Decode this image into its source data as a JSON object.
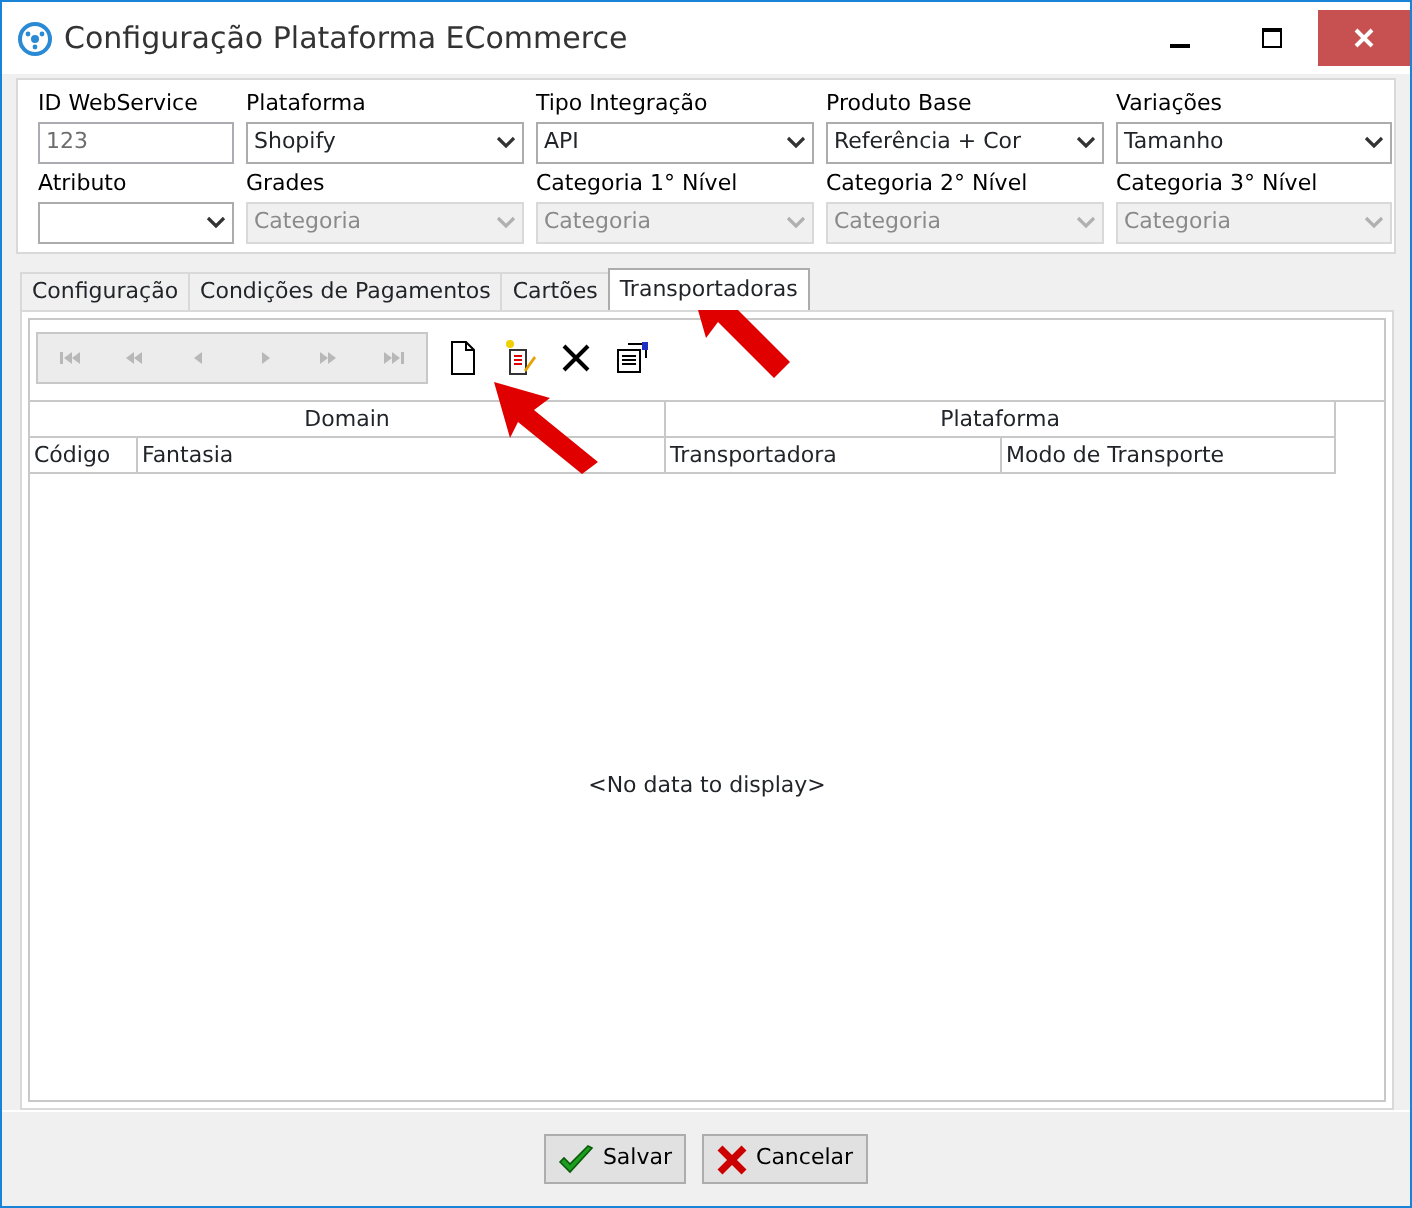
{
  "window": {
    "title": "Configuração Plataforma ECommerce"
  },
  "fields": [
    {
      "label": "ID WebService",
      "kind": "text",
      "value": "123",
      "disabled": false
    },
    {
      "label": "Plataforma",
      "kind": "select",
      "value": "Shopify",
      "disabled": false
    },
    {
      "label": "Tipo Integração",
      "kind": "select",
      "value": "API",
      "disabled": false
    },
    {
      "label": "Produto Base",
      "kind": "select",
      "value": "Referência + Cor",
      "disabled": false
    },
    {
      "label": "Variações",
      "kind": "select",
      "value": "Tamanho",
      "disabled": false
    },
    {
      "label": "Atributo",
      "kind": "select",
      "disabled": false
    },
    {
      "label": "Grades",
      "kind": "select",
      "value": "Categoria",
      "disabled": true
    },
    {
      "label": "Categoria 1° Nível",
      "kind": "select",
      "value": "Categoria",
      "disabled": true
    },
    {
      "label": "Categoria 2° Nível",
      "kind": "select",
      "value": "Categoria",
      "disabled": true
    },
    {
      "label": "Categoria 3° Nível",
      "kind": "select",
      "value": "Categoria",
      "disabled": true
    }
  ],
  "tabs": [
    {
      "label": "Configuração",
      "selected": false
    },
    {
      "label": "Condições de Pagamentos",
      "selected": false
    },
    {
      "label": "Cartões",
      "selected": false
    },
    {
      "label": "Transportadoras",
      "selected": true
    }
  ],
  "navigator": {
    "disabled": true
  },
  "grid": {
    "bands": [
      {
        "label": "Domain"
      },
      {
        "label": "Plataforma"
      }
    ],
    "columns": [
      {
        "label": "Código"
      },
      {
        "label": "Fantasia"
      },
      {
        "label": "Transportadora"
      },
      {
        "label": "Modo de Transporte"
      }
    ],
    "empty_text": "<No data to display>"
  },
  "buttons": [
    {
      "kind": "save",
      "label": "Salvar"
    },
    {
      "kind": "cancel",
      "label": "Cancelar"
    }
  ]
}
